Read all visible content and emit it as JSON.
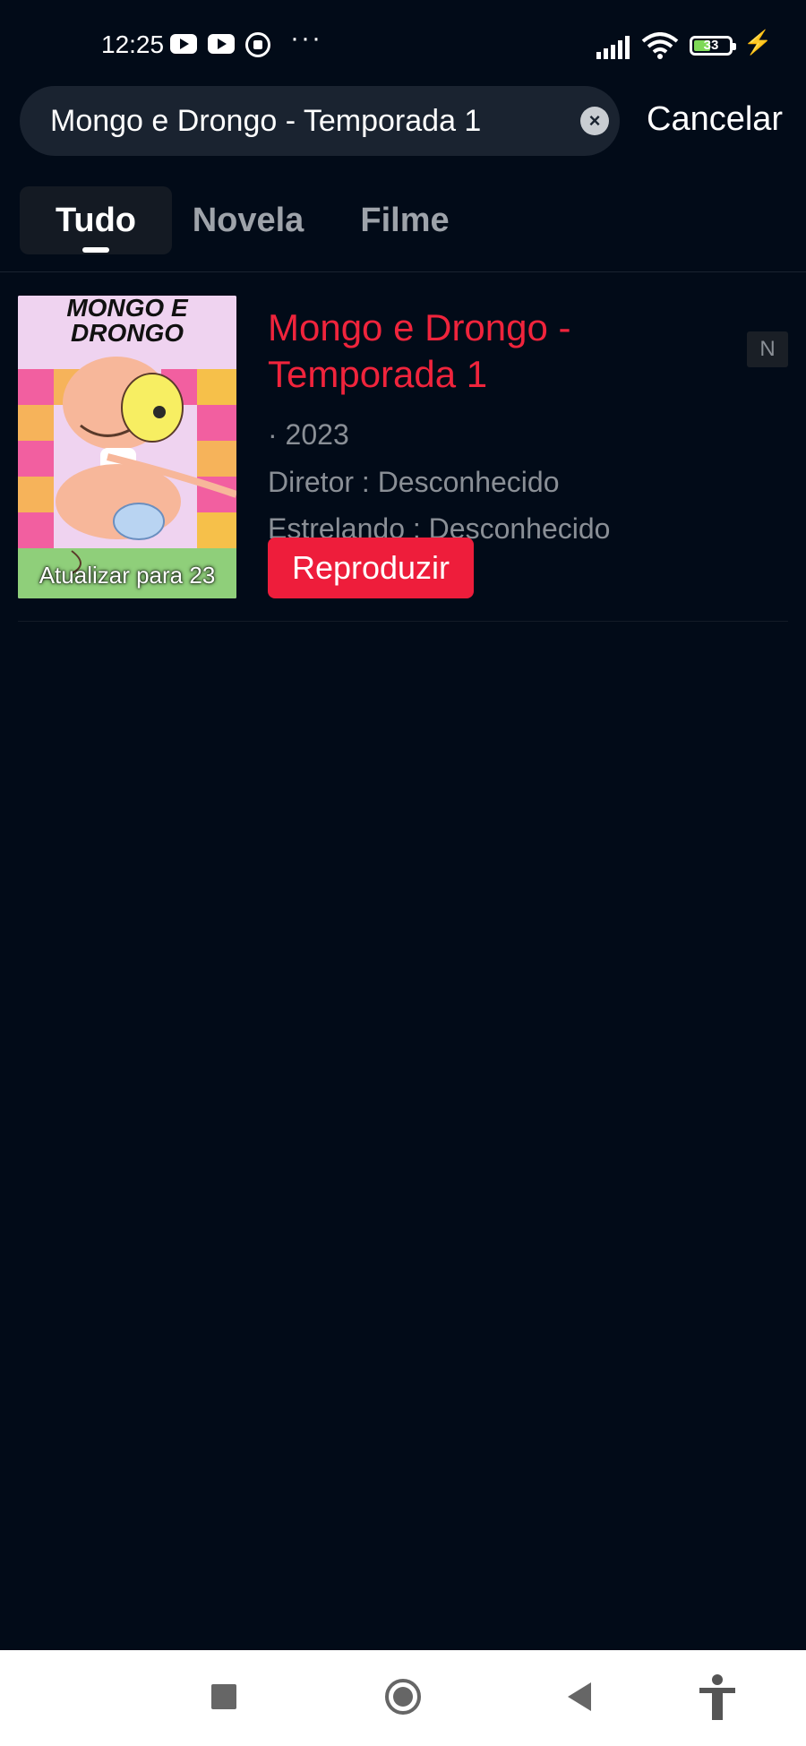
{
  "status_bar": {
    "time": "12:25",
    "battery": "33",
    "battery_fraction": 0.33,
    "icons": [
      "youtube-icon",
      "youtube-icon",
      "download-icon",
      "more-dots-icon",
      "signal-icon",
      "wifi-icon",
      "battery-icon",
      "charging-icon"
    ]
  },
  "search": {
    "value": "Mongo e Drongo - Temporada 1",
    "clear_icon": "×",
    "cancel_label": "Cancelar"
  },
  "tabs": [
    {
      "label": "Tudo",
      "active": true
    },
    {
      "label": "Novela",
      "active": false
    },
    {
      "label": "Filme",
      "active": false
    }
  ],
  "result": {
    "poster_title": "MONGO E DRONGO",
    "poster_caption": "Atualizar para 23",
    "title": "Mongo e Drongo - Temporada 1",
    "badge": "N",
    "year": "· 2023",
    "director": "Diretor : Desconhecido",
    "starring": "Estrelando : Desconhecido",
    "play_label": "Reproduzir"
  },
  "colors": {
    "background": "#020b18",
    "accent": "#ee1d3b",
    "title_red": "#f0243c"
  },
  "nav_bar": {
    "icons": [
      "recent-apps-icon",
      "home-icon",
      "back-icon",
      "accessibility-icon"
    ]
  }
}
